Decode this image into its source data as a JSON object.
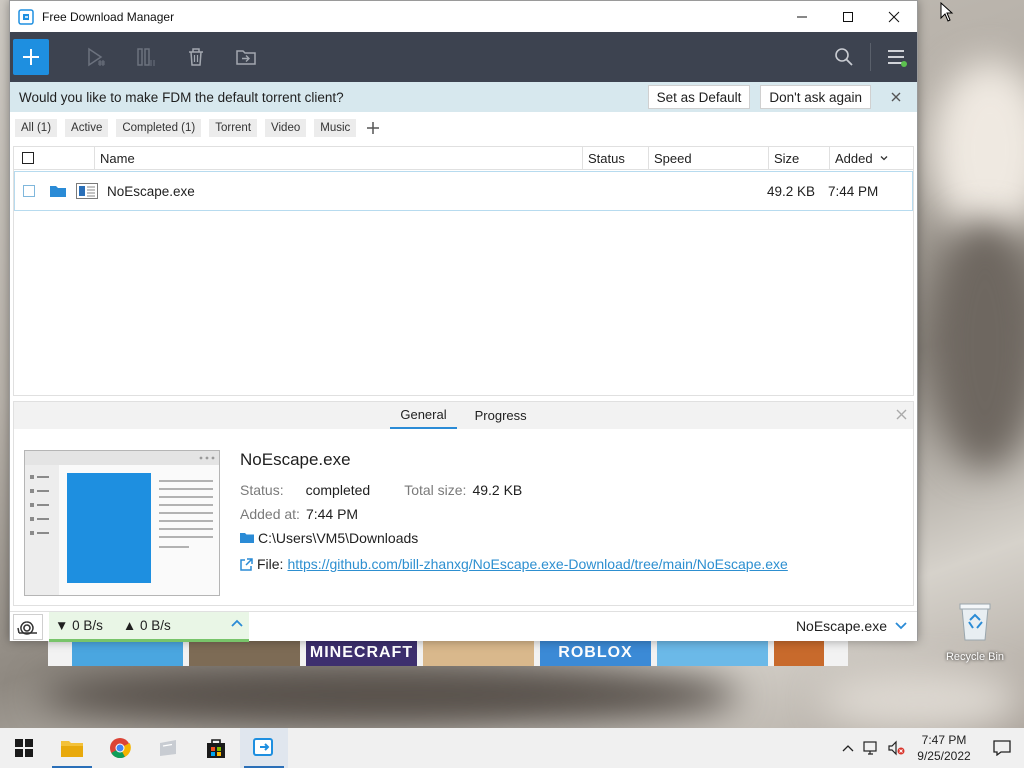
{
  "window": {
    "title": "Free Download Manager"
  },
  "notice": {
    "message": "Would you like to make FDM the default torrent client?",
    "set_default": "Set as Default",
    "dont_ask": "Don't ask again"
  },
  "filters": [
    "All (1)",
    "Active",
    "Completed (1)",
    "Torrent",
    "Video",
    "Music"
  ],
  "columns": {
    "name": "Name",
    "status": "Status",
    "speed": "Speed",
    "size": "Size",
    "added": "Added"
  },
  "downloads": [
    {
      "name": "NoEscape.exe",
      "status": "",
      "speed": "",
      "size": "49.2 KB",
      "added": "7:44 PM"
    }
  ],
  "details": {
    "tabs": [
      "General",
      "Progress"
    ],
    "file_name": "NoEscape.exe",
    "status_label": "Status:",
    "status_value": "completed",
    "total_label": "Total size:",
    "total_value": "49.2 KB",
    "added_label": "Added at:",
    "added_value": "7:44 PM",
    "folder": "C:\\Users\\VM5\\Downloads",
    "file_label": "File:",
    "url": "https://github.com/bill-zhanxg/NoEscape.exe-Download/tree/main/NoEscape.exe"
  },
  "statusbar": {
    "down_speed": "0 B/s",
    "up_speed": "0 B/s",
    "current_file": "NoEscape.exe"
  },
  "desktop": {
    "recycle_bin": "Recycle Bin",
    "strip_tiles": [
      "",
      "",
      "MINECRAFT",
      "",
      "ROBLOX",
      "",
      ""
    ]
  },
  "taskbar": {
    "time": "7:47 PM",
    "date": "9/25/2022"
  },
  "colors": {
    "accent": "#1e8fe0",
    "toolbar": "#3d4350",
    "notice_bg": "#d7e8ee",
    "link": "#2d8fd0"
  }
}
